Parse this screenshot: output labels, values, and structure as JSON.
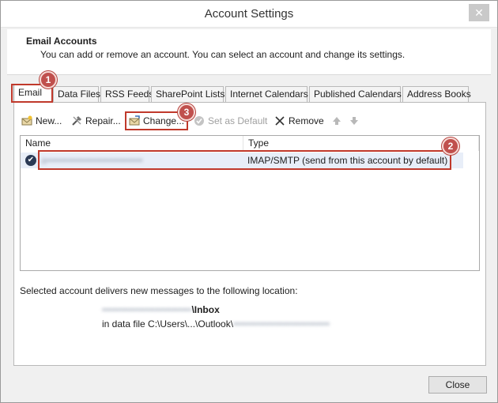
{
  "window": {
    "title": "Account Settings"
  },
  "header": {
    "title": "Email Accounts",
    "description": "You can add or remove an account. You can select an account and change its settings."
  },
  "tabs": [
    {
      "label": "Email",
      "active": true
    },
    {
      "label": "Data Files"
    },
    {
      "label": "RSS Feeds"
    },
    {
      "label": "SharePoint Lists"
    },
    {
      "label": "Internet Calendars"
    },
    {
      "label": "Published Calendars"
    },
    {
      "label": "Address Books"
    }
  ],
  "toolbar": {
    "new_label": "New...",
    "repair_label": "Repair...",
    "change_label": "Change...",
    "set_default_label": "Set as Default",
    "remove_label": "Remove"
  },
  "accounts_list": {
    "columns": [
      "Name",
      "Type"
    ],
    "rows": [
      {
        "name": "a•••••••••••••••••••••••••••••",
        "type": "IMAP/SMTP (send from this account by default)"
      }
    ]
  },
  "delivery": {
    "text": "Selected account delivers new messages to the following location:",
    "mailbox_blurred": "•••••••••••••••••••••••••••",
    "folder": "\\Inbox",
    "datafile_prefix": "in data file C:\\Users\\...\\Outlook\\",
    "datafile_blurred": "•••••••••••••••••••••••••••••"
  },
  "footer": {
    "close_label": "Close"
  },
  "annotations": [
    {
      "number": "1"
    },
    {
      "number": "2"
    },
    {
      "number": "3"
    }
  ],
  "colors": {
    "annotation_red": "#c0392b",
    "selected_row": "#e8eef8"
  },
  "icons": {
    "close": "close-icon",
    "new": "new-account-icon",
    "repair": "repair-icon",
    "change": "change-icon",
    "set_default": "check-circle-icon",
    "remove": "remove-x-icon",
    "move_up": "arrow-up-icon",
    "move_down": "arrow-down-icon",
    "default_account": "default-check-icon"
  }
}
